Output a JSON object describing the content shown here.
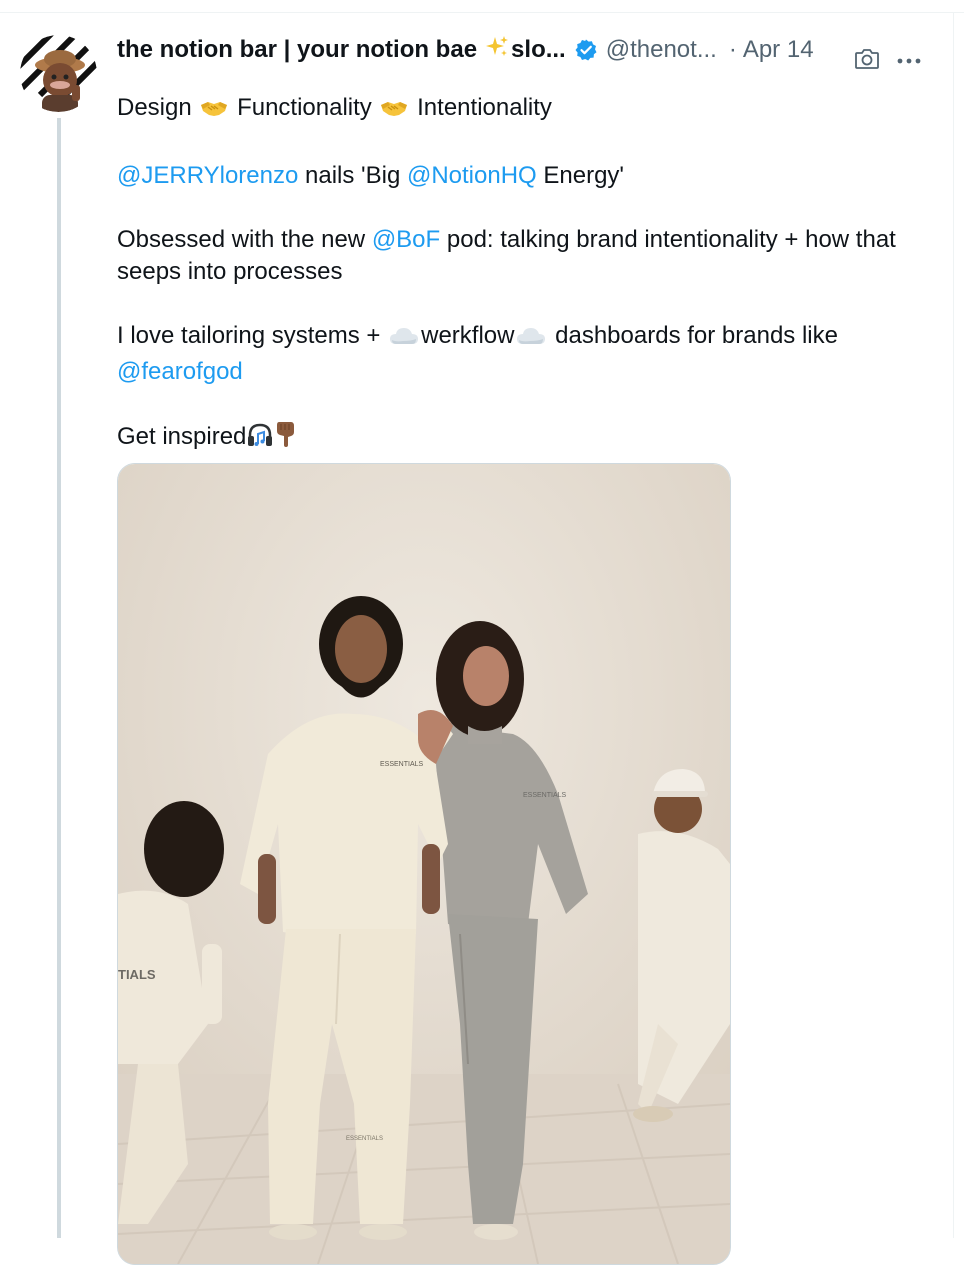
{
  "author": {
    "display_name": "the notion bar | your notion bae",
    "name_suffix": "slo...",
    "handle": "@thenot...",
    "separator": "·",
    "date": "Apr 14",
    "avatar_icon": "profile-avatar",
    "verified_icon": "verified-badge-icon",
    "sparkle_icon": "sparkles-icon"
  },
  "actions": {
    "camera_icon": "camera-icon",
    "more_icon": "more-options-icon",
    "more_label": "···"
  },
  "tweet": {
    "line1": {
      "w1": "Design",
      "w2": "Functionality",
      "w3": "Intentionality",
      "emoji": "handshake-icon"
    },
    "line2": {
      "mention1": "@JERRYlorenzo",
      "text1": " nails 'Big ",
      "mention2": "@NotionHQ",
      "text2": " Energy'"
    },
    "line3": {
      "text1": "Obsessed with the new ",
      "mention": "@BoF",
      "text2": " pod: talking brand intentionality + how that seeps into processes"
    },
    "line4": {
      "text1": "I love tailoring systems + ",
      "text2": "werkflow",
      "text3": " dashboards for brands like ",
      "mention": "@fearofgod",
      "emoji": "cloud-icon"
    },
    "line5": {
      "text": "Get inspired",
      "emoji1": "headphones-icon",
      "emoji2": "pointing-down-icon"
    }
  },
  "media": {
    "type": "photo",
    "labels": {
      "man_hoodie": "ESSENTIALS",
      "woman_sweat": "ESSENTIALS",
      "pants": "ESSENTIALS",
      "child_back": "TIALS"
    },
    "colors": {
      "background": "#e7ded2",
      "floor": "#d9cfc3",
      "cream": "#efe8d8",
      "gray": "#9c9a96",
      "skin": "#8a5e43",
      "hair": "#1f1812"
    }
  },
  "colors": {
    "link": "#1d9bf0",
    "text": "#0f1419",
    "secondary": "#536471",
    "thread": "#cfd9de"
  }
}
